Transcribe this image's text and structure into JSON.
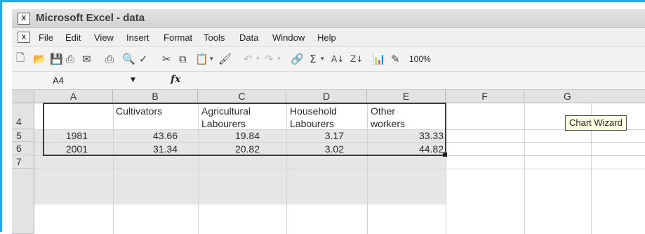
{
  "window": {
    "title": "Microsoft Excel - data"
  },
  "menu": {
    "items": [
      "File",
      "Edit",
      "View",
      "Insert",
      "Format",
      "Tools",
      "Data",
      "Window",
      "Help"
    ]
  },
  "toolbar": {
    "buttons": [
      "new-icon",
      "open-icon",
      "save-icon",
      "permission-icon",
      "email-icon",
      "print-icon",
      "print-preview-icon",
      "spelling-icon",
      "cut-icon",
      "copy-icon",
      "paste-icon",
      "format-painter-icon",
      "undo-icon",
      "redo-icon",
      "hyperlink-icon",
      "autosum-icon",
      "sort-ascending-icon",
      "sort-descending-icon",
      "chart-wizard-icon",
      "drawing-icon"
    ],
    "zoom": "100%",
    "autosum_symbol": "Σ"
  },
  "formula_bar": {
    "name_box": "A4",
    "fx_label": "fx"
  },
  "sheet": {
    "columns": [
      "A",
      "B",
      "C",
      "D",
      "E",
      "F",
      "G"
    ],
    "rows": [
      "4",
      "5",
      "6",
      "7"
    ],
    "header_row": {
      "B": [
        "Cultivators",
        ""
      ],
      "C": [
        "Agricultural",
        "Labourers"
      ],
      "D": [
        "Household",
        "Labourers"
      ],
      "E": [
        "Other",
        "workers"
      ]
    },
    "data": [
      {
        "row": "5",
        "A": "1981",
        "B": "43.66",
        "C": "19.84",
        "D": "3.17",
        "E": "33.33"
      },
      {
        "row": "6",
        "A": "2001",
        "B": "31.34",
        "C": "20.82",
        "D": "3.02",
        "E": "44.82"
      }
    ]
  },
  "tooltip": {
    "text": "Chart Wizard"
  }
}
